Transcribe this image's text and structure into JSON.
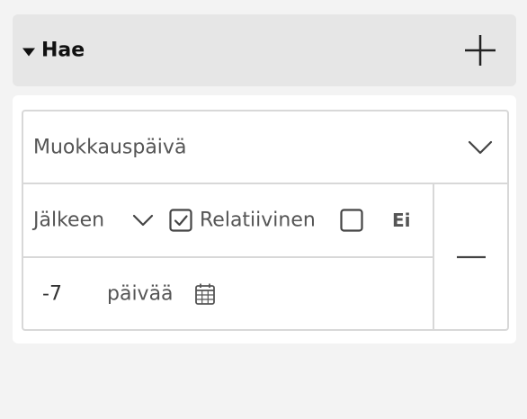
{
  "header": {
    "title": "Hae",
    "collapse_icon": "caret-down-icon",
    "add_icon": "plus-icon"
  },
  "filter": {
    "field_label": "Muokkauspäivä",
    "field_chevron_icon": "chevron-down-icon",
    "operator_label": "Jälkeen",
    "relative_checked": true,
    "relative_label": "Relatiivinen",
    "negate_checked": false,
    "negate_label": "Ei",
    "value": "-7",
    "unit_label": "päivää",
    "calendar_icon": "calendar-icon",
    "remove_icon": "minus-icon"
  },
  "colors": {
    "page_bg": "#f3f3f3",
    "header_bg": "#e6e6e6",
    "panel_bg": "#ffffff",
    "border": "#d8d8d8",
    "text": "#555555",
    "title_text": "#111111"
  }
}
